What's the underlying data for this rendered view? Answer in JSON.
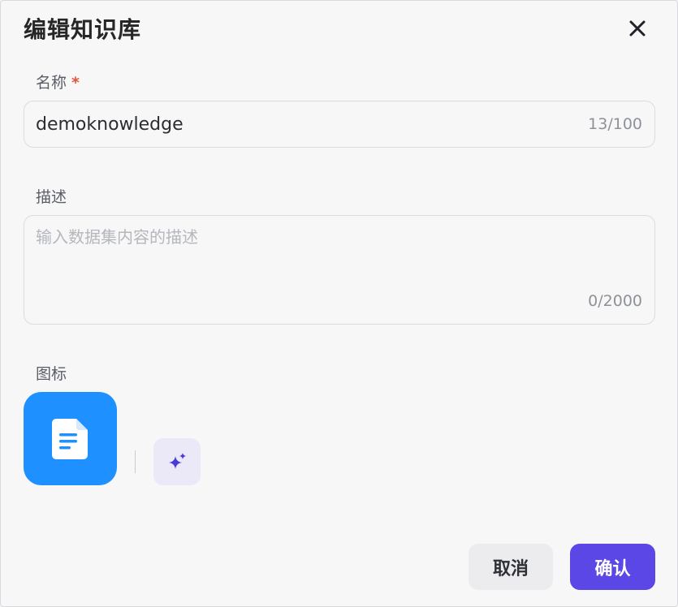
{
  "dialog": {
    "title": "编辑知识库",
    "close_icon": "close-icon"
  },
  "name_field": {
    "label": "名称",
    "required_mark": "*",
    "value": "demoknowledge",
    "counter": "13/100"
  },
  "description_field": {
    "label": "描述",
    "placeholder": "输入数据集内容的描述",
    "value": "",
    "counter": "0/2000"
  },
  "icon_field": {
    "label": "图标",
    "selected_icon": "document-icon",
    "selected_color": "#1e90ff",
    "ai_generate_icon": "sparkle-icon"
  },
  "footer": {
    "cancel_label": "取消",
    "confirm_label": "确认"
  },
  "colors": {
    "accent": "#5b47e6",
    "icon_bg": "#1e90ff",
    "required": "#e5533c"
  }
}
